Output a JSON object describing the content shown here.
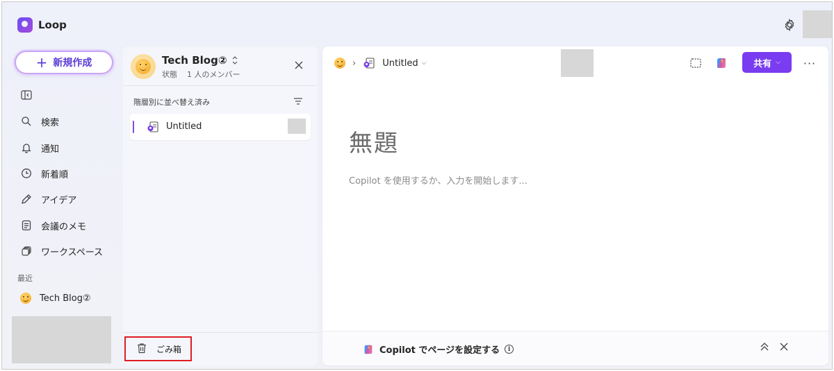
{
  "app": {
    "name": "Loop"
  },
  "left_nav": {
    "new_button": "新規作成",
    "items": [
      {
        "label": "",
        "icon": "collapse-panel-icon"
      },
      {
        "label": "検索",
        "icon": "search-icon"
      },
      {
        "label": "通知",
        "icon": "bell-icon"
      },
      {
        "label": "新着順",
        "icon": "clock-icon"
      },
      {
        "label": "アイデア",
        "icon": "pen-icon"
      },
      {
        "label": "会議のメモ",
        "icon": "notes-icon"
      },
      {
        "label": "ワークスペース",
        "icon": "workspace-icon"
      }
    ],
    "recent_label": "最近",
    "recent_items": [
      {
        "label": "Tech Blog②",
        "icon": "smiley-emoji-icon"
      }
    ]
  },
  "workspace": {
    "title": "Tech Blog②",
    "status_label": "状態",
    "members_label": "1 人のメンバー",
    "sort_label": "階層別に並べ替え済み",
    "pages": [
      {
        "label": "Untitled"
      }
    ],
    "trash_label": "ごみ箱"
  },
  "editor": {
    "breadcrumb_page": "Untitled",
    "share_label": "共有",
    "doc_title": "無題",
    "hint": "Copilot を使用するか、入力を開始します...",
    "copilot_bar_label": "Copilot でページを設定する"
  },
  "colors": {
    "accent": "#7a3cf0",
    "highlight_border": "#e01b24"
  }
}
